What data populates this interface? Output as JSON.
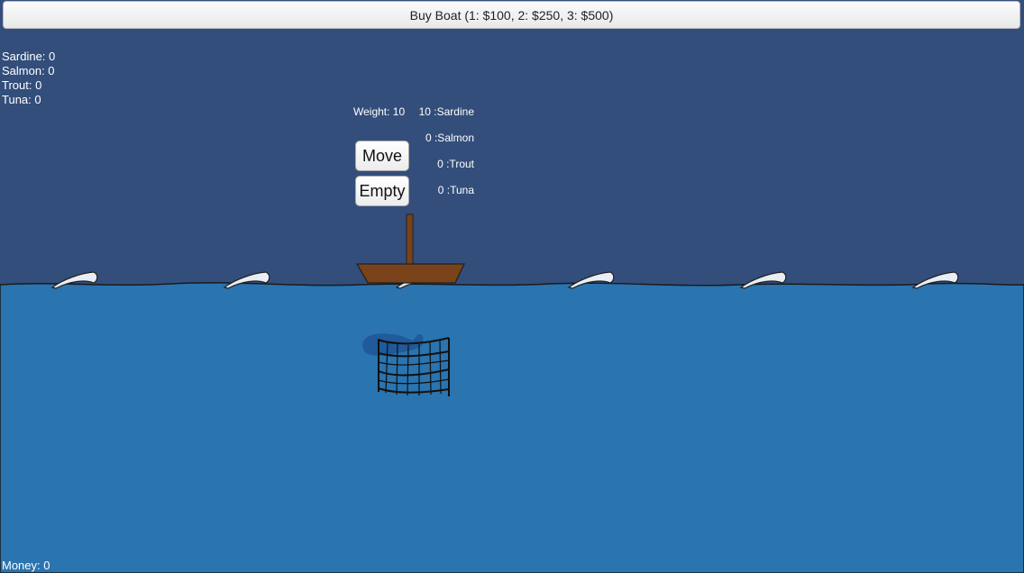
{
  "buy_boat_label": "Buy Boat (1: $100, 2: $250, 3: $500)",
  "inventory": [
    {
      "name": "Sardine",
      "count": "0",
      "text": "Sardine: 0"
    },
    {
      "name": "Salmon",
      "count": "0",
      "text": "Salmon: 0"
    },
    {
      "name": "Trout",
      "count": "0",
      "text": "Trout: 0"
    },
    {
      "name": "Tuna",
      "count": "0",
      "text": "Tuna: 0"
    }
  ],
  "money_text": "Money: 0",
  "boat": {
    "weight_text": "Weight: 10",
    "catch": [
      {
        "text": "10 :Sardine"
      },
      {
        "text": "0 :Salmon"
      },
      {
        "text": "0 :Trout"
      },
      {
        "text": "0 :Tuna"
      }
    ],
    "move_label": "Move",
    "empty_label": "Empty"
  },
  "colors": {
    "sky": "#334e7b",
    "sea": "#2a74b0",
    "boat_hull": "#7a4218",
    "wave_cap": "#e8eef4",
    "fish_shadow": "#1f5a9a"
  },
  "icons": [
    "boat-icon",
    "fishing-net-icon",
    "fish-shadow-icon",
    "wave-crest-icon"
  ]
}
